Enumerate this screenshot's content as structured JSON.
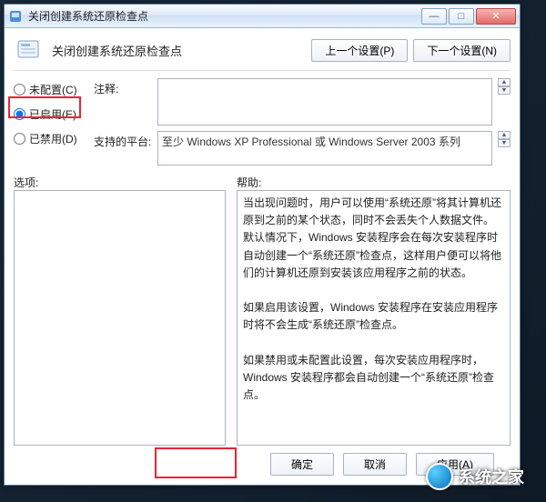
{
  "titlebar": {
    "title": "关闭创建系统还原检查点"
  },
  "header": {
    "title": "关闭创建系统还原检查点",
    "prev_btn": "上一个设置(P)",
    "next_btn": "下一个设置(N)"
  },
  "radios": {
    "not_configured": "未配置(C)",
    "enabled": "已启用(E)",
    "disabled": "已禁用(D)"
  },
  "labels": {
    "comment": "注释:",
    "platform": "支持的平台:",
    "options": "选项:",
    "help": "帮助:"
  },
  "fields": {
    "comment_value": "",
    "platform_value": "至少 Windows XP Professional 或 Windows Server 2003 系列"
  },
  "help_text": "当出现问题时，用户可以使用“系统还原”将其计算机还原到之前的某个状态，同时不会丢失个人数据文件。默认情况下，Windows 安装程序会在每次安装程序时自动创建一个“系统还原”检查点，这样用户便可以将他们的计算机还原到安装该应用程序之前的状态。\n\n如果启用该设置，Windows 安装程序在安装应用程序时将不会生成“系统还原”检查点。\n\n如果禁用或未配置此设置，每次安装应用程序时，Windows 安装程序都会自动创建一个“系统还原”检查点。",
  "buttons": {
    "ok": "确定",
    "cancel": "取消",
    "apply": "应用(A)"
  },
  "watermark": "系统之家"
}
